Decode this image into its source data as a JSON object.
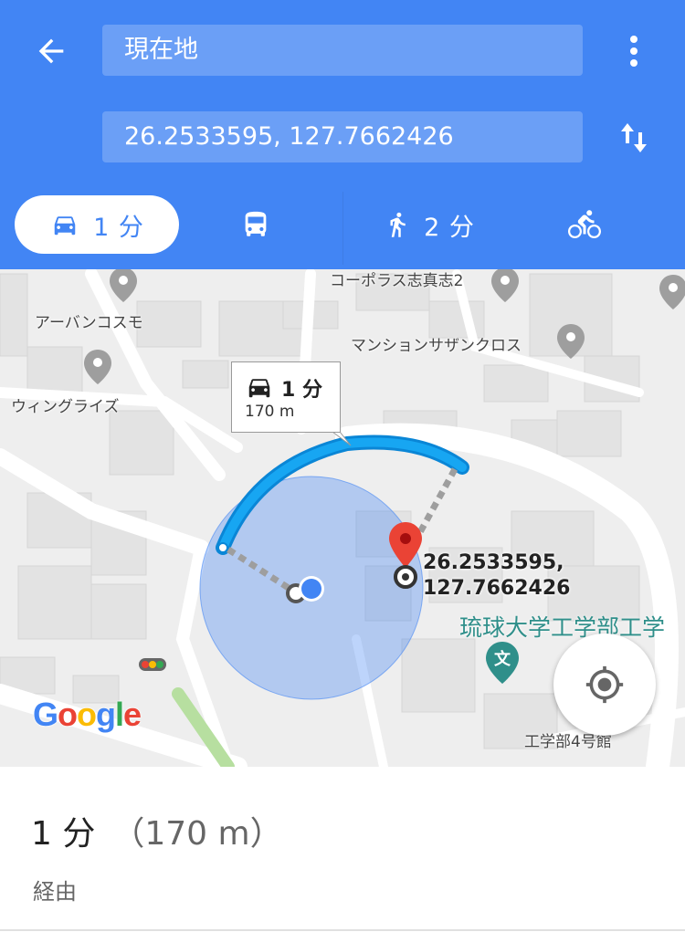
{
  "header": {
    "origin": "現在地",
    "destination": "26.2533595, 127.7662426"
  },
  "modes": [
    {
      "name": "drive",
      "label": "1 分",
      "active": true
    },
    {
      "name": "transit",
      "label": ""
    },
    {
      "name": "walk",
      "label": "2 分"
    },
    {
      "name": "bicycle",
      "label": ""
    }
  ],
  "map": {
    "pois": [
      "コーポラス志真志2",
      "アーバンコスモ",
      "マンションサザンクロス",
      "ウィングライズ",
      "工学部4号館"
    ],
    "route_callout": {
      "duration": "1 分",
      "distance": "170 m"
    },
    "destination_label": [
      "26.2533595,",
      "127.7662426"
    ],
    "campus_label": "琉球大学工学部工学",
    "campus_icon": "文",
    "logo": [
      "G",
      "o",
      "o",
      "g",
      "l",
      "e"
    ]
  },
  "colors": {
    "primary": "#4285f4",
    "route": "#12a0f0",
    "pin": "#ea4335",
    "campus": "#2f8f8a"
  },
  "summary": {
    "duration": "1 分",
    "distance": "（170 m）",
    "via": "経由"
  }
}
